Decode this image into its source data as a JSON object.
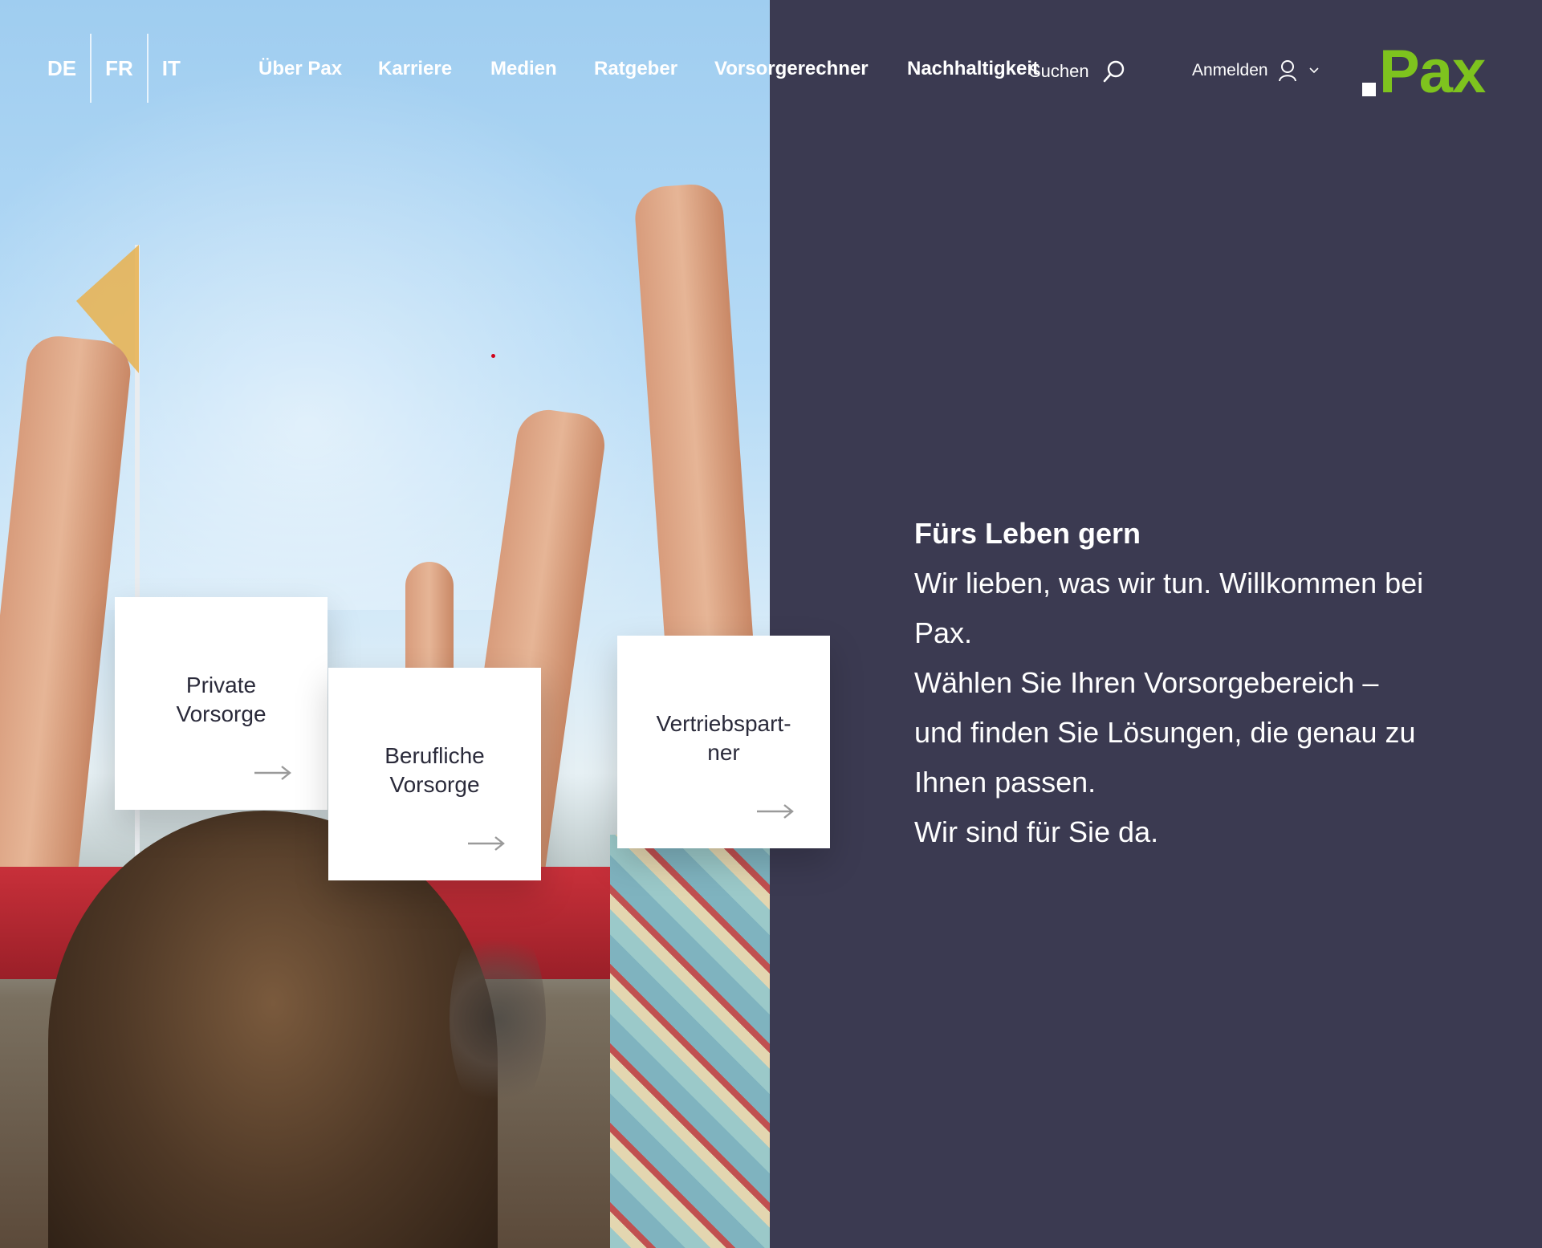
{
  "languages": [
    "DE",
    "FR",
    "IT"
  ],
  "nav": {
    "items": [
      "Über Pax",
      "Karriere",
      "Medien",
      "Ratgeber",
      "Vorsorgerechner",
      "Nachhaltigkeit"
    ]
  },
  "search": {
    "label": "Suchen",
    "icon": "search-icon"
  },
  "login": {
    "label": "Anmelden",
    "icon": "user-icon"
  },
  "logo": {
    "text": "Pax",
    "color": "#7ec31e"
  },
  "intro": {
    "title": "Fürs Leben gern",
    "line1": "Wir lieben, was wir tun. Willkommen bei Pax.",
    "line2": "Wählen Sie Ihren Vorsorgebereich – und finden Sie Lösungen, die genau zu Ihnen passen.",
    "line3": "Wir sind für Sie da."
  },
  "cards": [
    {
      "label": "Private Vorsorge"
    },
    {
      "label": "Berufliche Vorsorge"
    },
    {
      "label": "Vertriebspart-ner"
    }
  ],
  "colors": {
    "panel": "#3b3a51",
    "accent": "#7ec31e"
  }
}
